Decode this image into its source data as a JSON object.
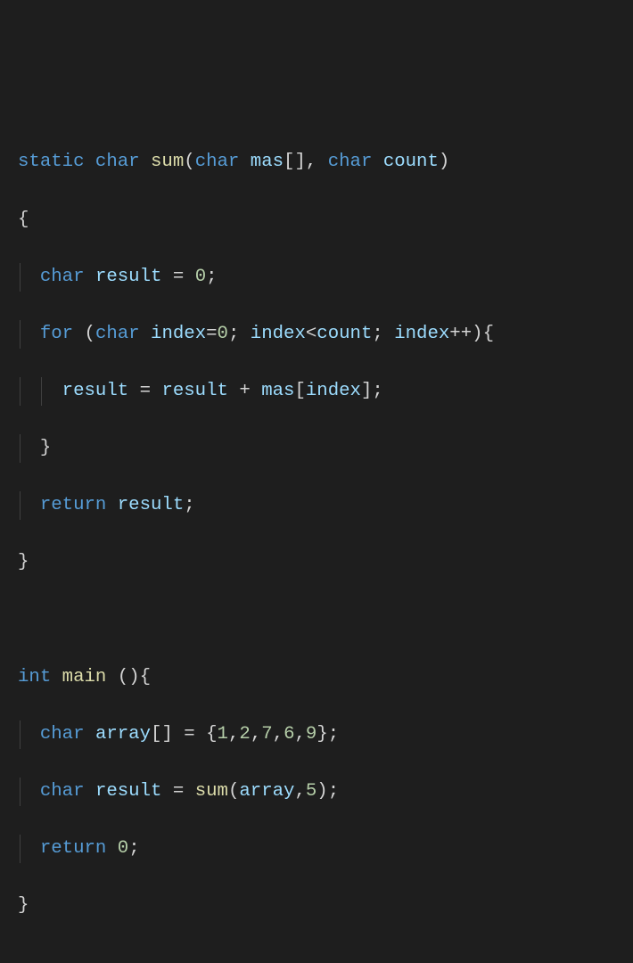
{
  "tokens": {
    "kw_static": "static",
    "kw_char": "char",
    "kw_for": "for",
    "kw_return": "return",
    "kw_int": "int",
    "fn_sum": "sum",
    "fn_main": "main",
    "var_mas": "mas",
    "var_count": "count",
    "var_result": "result",
    "var_index": "index",
    "var_array": "array",
    "n0": "0",
    "n1": "1",
    "n2": "2",
    "n5": "5",
    "n6": "6",
    "n7": "7",
    "n9": "9",
    "lbrace": "{",
    "rbrace": "}",
    "lparen": "(",
    "rparen": ")",
    "lbrack": "[",
    "rbrack": "]",
    "semi": ";",
    "comma": ",",
    "eq": "=",
    "lt": "<",
    "plus": "+",
    "inc": "++",
    "sp": " "
  }
}
